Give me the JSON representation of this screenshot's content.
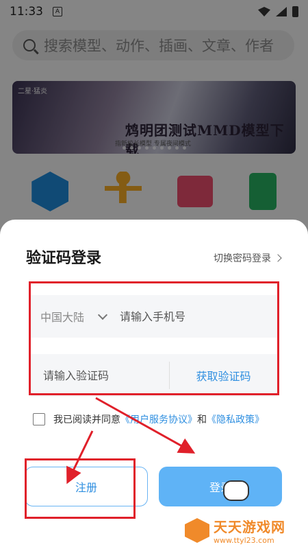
{
  "status_bar": {
    "time": "11:33",
    "notif_letter": "A"
  },
  "search": {
    "placeholder": "搜索模型、动作、插画、文章、作者"
  },
  "banner": {
    "tag": "二星·猛炎",
    "title": "鸩明团测试MMD模型下载",
    "subtitle": "指新校长模型  专属夜间模式"
  },
  "app_icons": [
    "cube-icon",
    "figure-icon",
    "image-icon",
    "document-icon"
  ],
  "login_sheet": {
    "title": "验证码登录",
    "switch_link": "切换密码登录",
    "region": "中国大陆",
    "phone_placeholder": "请输入手机号",
    "code_placeholder": "请输入验证码",
    "get_code": "获取验证码",
    "agree_prefix": "我已阅读并同意",
    "terms_link": "《用户服务协议》",
    "and": "和",
    "privacy_link": "《隐私政策》",
    "register_label": "注册",
    "login_label": "登录"
  },
  "watermark": {
    "title": "天天游戏网",
    "url": "www.ttyl23.com"
  },
  "colors": {
    "accent": "#2f8fe0",
    "login_button": "#5fb3f6",
    "highlight_red": "#e0202a",
    "watermark_orange": "#f08a2a"
  }
}
